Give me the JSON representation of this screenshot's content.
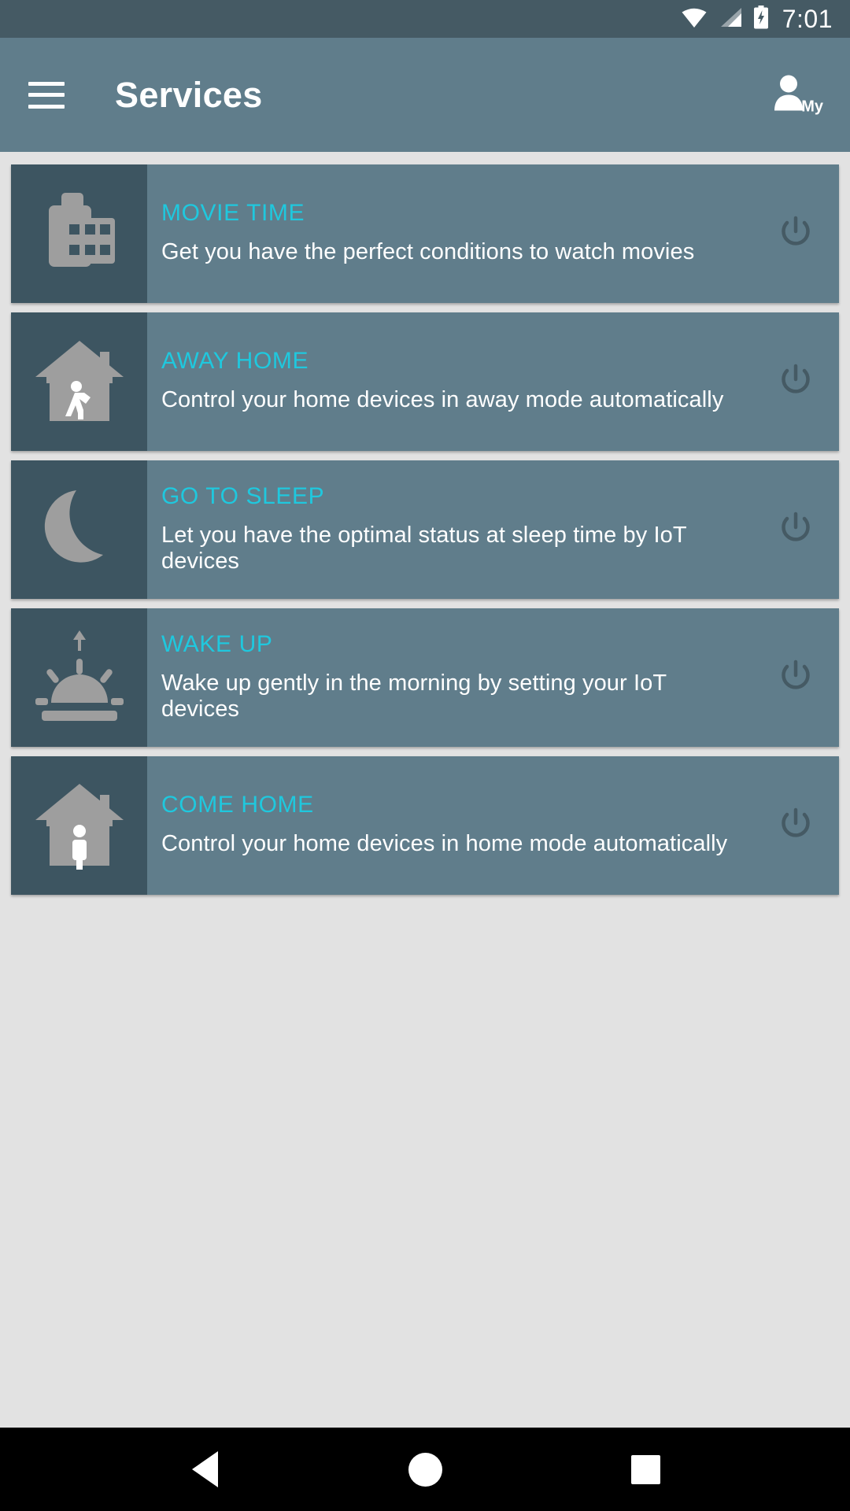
{
  "statusbar": {
    "time": "7:01",
    "icons": [
      "wifi-icon",
      "signal-icon",
      "battery-charging-icon"
    ]
  },
  "appbar": {
    "menu_icon": "hamburger-menu-icon",
    "title": "Services",
    "account_icon": "person-icon",
    "account_label": "My"
  },
  "colors": {
    "accent_title": "#1fc8de",
    "card_body": "#607d8b",
    "card_icon_tile": "#3d5561",
    "appbar": "#607d8b",
    "statusbar": "#455a64",
    "content_bg": "#e2e2e2",
    "icon_glyph": "#9e9e9e",
    "power_icon": "#455a64"
  },
  "services": [
    {
      "icon": "cinema-building-icon",
      "title": "MOVIE TIME",
      "description": "Get you have the perfect conditions to watch movies",
      "power_icon": "power-toggle-icon"
    },
    {
      "icon": "house-walking-person-icon",
      "title": "AWAY HOME",
      "description": "Control your home devices in away mode automatically",
      "power_icon": "power-toggle-icon"
    },
    {
      "icon": "crescent-moon-icon",
      "title": "GO TO SLEEP",
      "description": "Let you have the optimal status at sleep time by IoT devices",
      "power_icon": "power-toggle-icon"
    },
    {
      "icon": "sunrise-icon",
      "title": "WAKE UP",
      "description": "Wake up gently in the morning by setting your IoT devices",
      "power_icon": "power-toggle-icon"
    },
    {
      "icon": "house-standing-person-icon",
      "title": "COME HOME",
      "description": "Control your home devices in home mode automatically",
      "power_icon": "power-toggle-icon"
    }
  ],
  "navbar": {
    "back": "back-triangle-icon",
    "home": "home-circle-icon",
    "recents": "recents-square-icon"
  }
}
